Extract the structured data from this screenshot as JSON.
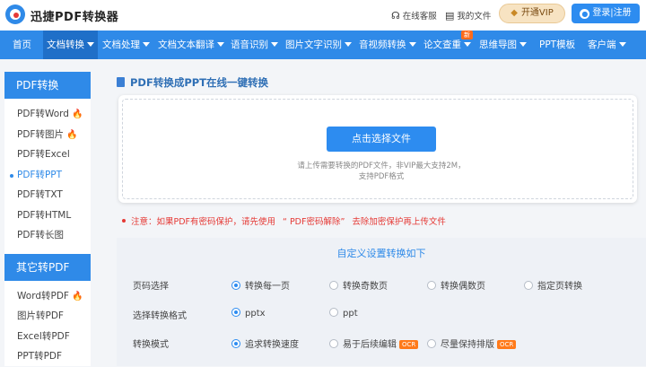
{
  "app": {
    "logo_text": "迅捷PDF转换器"
  },
  "topbar": {
    "service_label": "在线客服",
    "files_label": "我的文件",
    "vip_label": "开通VIP",
    "login_label": "登录|注册"
  },
  "nav": {
    "items": [
      {
        "label": "首页"
      },
      {
        "label": "文档转换"
      },
      {
        "label": "文档处理"
      },
      {
        "label": "文档文本翻译"
      },
      {
        "label": "语音识别"
      },
      {
        "label": "图片文字识别"
      },
      {
        "label": "音视频转换"
      },
      {
        "label": "论文查重"
      },
      {
        "label": "思维导图"
      },
      {
        "label": "PPT模板"
      },
      {
        "label": "客户端"
      }
    ],
    "new_badge": "新"
  },
  "sidebar": {
    "group1_title": "PDF转换",
    "group1_items": [
      {
        "label": "PDF转Word"
      },
      {
        "label": "PDF转图片"
      },
      {
        "label": "PDF转Excel"
      },
      {
        "label": "PDF转PPT"
      },
      {
        "label": "PDF转TXT"
      },
      {
        "label": "PDF转HTML"
      },
      {
        "label": "PDF转长图"
      }
    ],
    "group2_title": "其它转PDF",
    "group2_items": [
      {
        "label": "Word转PDF"
      },
      {
        "label": "图片转PDF"
      },
      {
        "label": "Excel转PDF"
      },
      {
        "label": "PPT转PDF"
      }
    ]
  },
  "main": {
    "title": "PDF转换成PPT在线一键转换",
    "choose_button": "点击选择文件",
    "upload_hint_line1": "请上传需要转换的PDF文件，非VIP最大支持2M，",
    "upload_hint_line2": "支持PDF格式",
    "notice_prefix": "注意：如果PDF有密码保护，请先使用",
    "notice_link": "“ PDF密码解除”",
    "notice_suffix": "去除加密保护再上传文件"
  },
  "settings": {
    "title": "自定义设置转换如下",
    "page_label": "页码选择",
    "page_options": [
      {
        "label": "转换每一页",
        "selected": true
      },
      {
        "label": "转换奇数页",
        "selected": false
      },
      {
        "label": "转换偶数页",
        "selected": false
      },
      {
        "label": "指定页转换",
        "selected": false
      }
    ],
    "format_label": "选择转换格式",
    "format_options": [
      {
        "label": "pptx",
        "selected": true
      },
      {
        "label": "ppt",
        "selected": false
      }
    ],
    "mode_label": "转换模式",
    "mode_options": [
      {
        "label": "追求转换速度",
        "selected": true
      },
      {
        "label": "易于后续编辑",
        "selected": false,
        "badge": "OCR"
      },
      {
        "label": "尽量保持排版",
        "selected": false,
        "badge": "OCR"
      }
    ]
  },
  "colors": {
    "brand_blue": "#2f8ae8",
    "accent_orange": "#ff6b1a",
    "warning_red": "#e53935"
  }
}
